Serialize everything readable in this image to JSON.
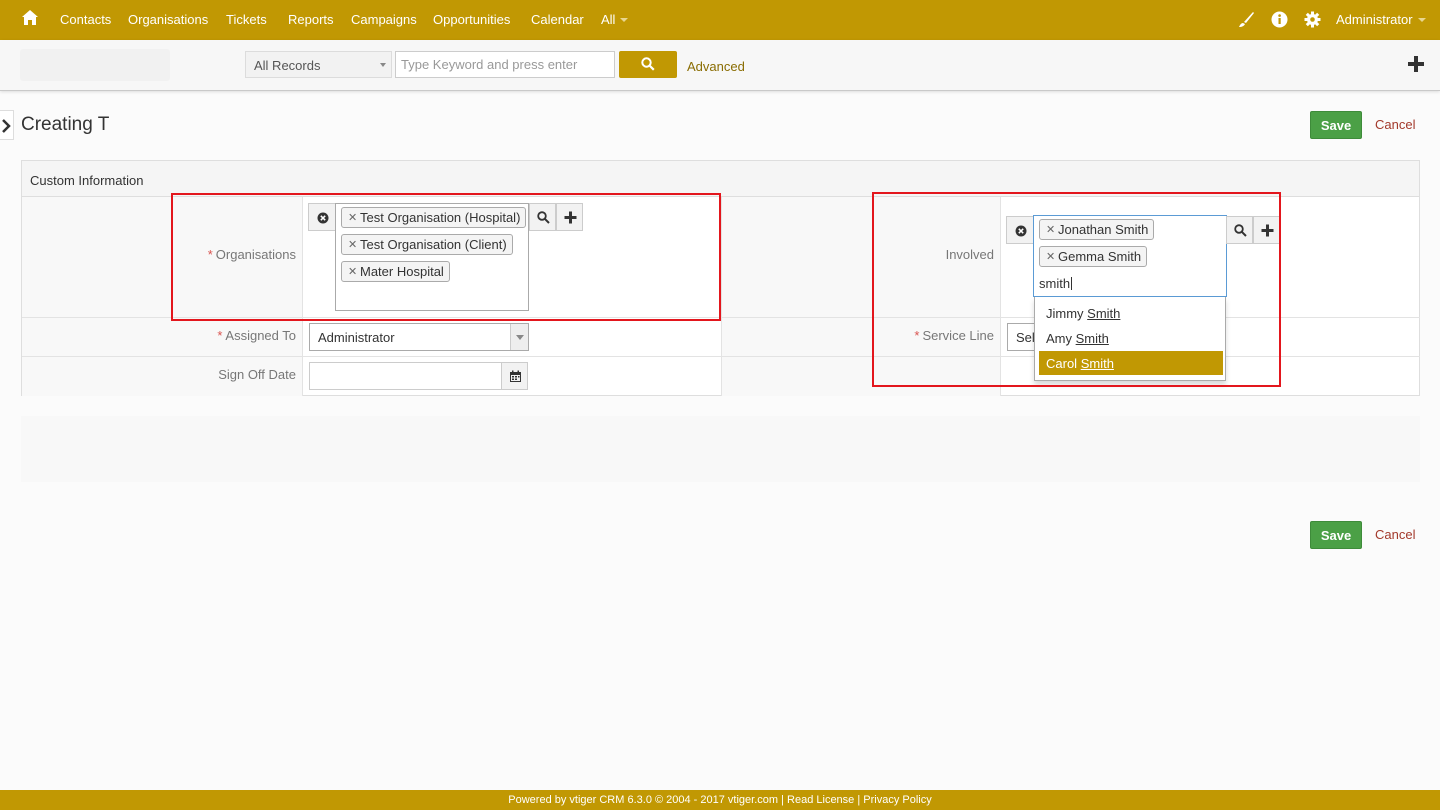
{
  "nav": {
    "items": [
      "Contacts",
      "Organisations",
      "Tickets",
      "Reports",
      "Campaigns",
      "Opportunities",
      "Calendar",
      "All"
    ],
    "user": "Administrator"
  },
  "search": {
    "records_selected": "All Records",
    "placeholder": "Type Keyword and press enter",
    "advanced": "Advanced"
  },
  "page": {
    "title": "Creating T",
    "save": "Save",
    "cancel": "Cancel"
  },
  "form": {
    "block_title": "Custom Information",
    "organisations_label": "Organisations",
    "organisations": [
      "Test Organisation (Hospital)",
      "Test Organisation (Client)",
      "Mater Hospital"
    ],
    "involved_label": "Involved",
    "involved": [
      "Jonathan Smith",
      "Gemma Smith"
    ],
    "involved_typed": "smith",
    "suggestions": [
      {
        "first": "Jimmy",
        "match": "Smith"
      },
      {
        "first": "Amy",
        "match": "Smith"
      },
      {
        "first": "Carol",
        "match": "Smith"
      }
    ],
    "assigned_label": "Assigned To",
    "assigned_value": "Administrator",
    "service_label": "Service Line",
    "service_value": "Sel",
    "signoff_label": "Sign Off Date",
    "required_mark": "*"
  },
  "footer": {
    "text": "Powered by vtiger CRM 6.3.0  © 2004 - 2017  vtiger.com | Read License | Privacy Policy"
  },
  "colors": {
    "brand": "#c19803",
    "save": "#4ba046",
    "highlight": "#e3161d"
  }
}
